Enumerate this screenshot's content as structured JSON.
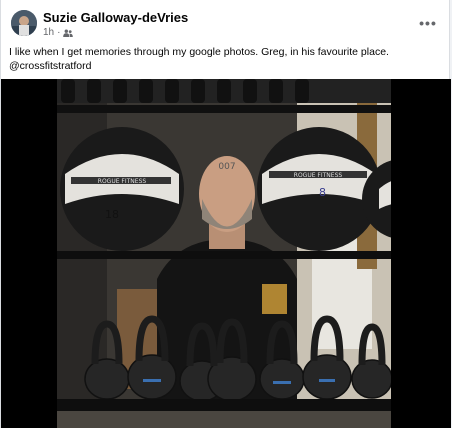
{
  "post": {
    "author": "Suzie Galloway-deVries",
    "time": "1h",
    "audience_icon": "friends-icon",
    "more_label": "•••",
    "caption_line1": "I like when I get memories through my google photos.   Greg, in his favourite place.",
    "caption_tag": "@crossfitstratford"
  },
  "photo": {
    "ball_left_number": "18",
    "ball_right_number": "8",
    "ball_left_brand": "ROGUE FITNESS",
    "ball_right_brand": "ROGUE FITNESS"
  },
  "colors": {
    "text": "#050505",
    "secondary_text": "#65676b",
    "background": "#ffffff"
  }
}
